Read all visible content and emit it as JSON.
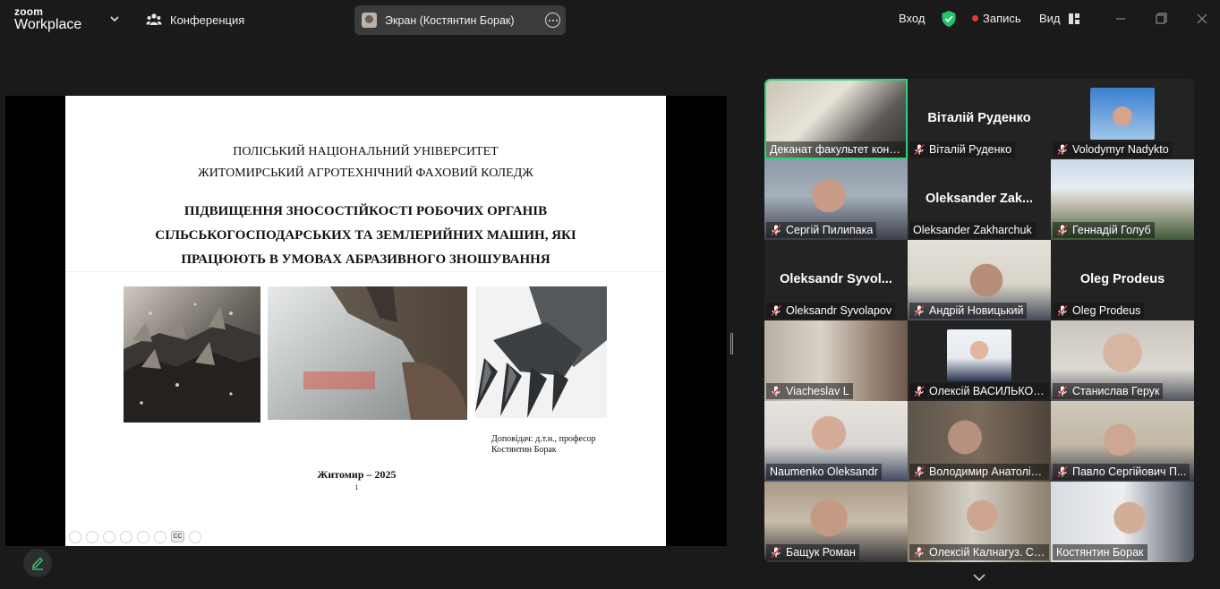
{
  "app": {
    "logo_top": "zoom",
    "logo_bottom": "Workplace",
    "meeting_label": "Конференция",
    "screen_share_label": "Экран (Костянтин Борак)",
    "login_label": "Вход",
    "record_label": "Запись",
    "view_label": "Вид",
    "shield_color": "#23c26b",
    "record_color": "#e53935",
    "active_speaker_color": "#2fd07a"
  },
  "slide": {
    "line1": "ПОЛІСЬКИЙ НАЦІОНАЛЬНИЙ УНІВЕРСИТЕТ",
    "line2": "ЖИТОМИРСЬКИЙ АГРОТЕХНІЧНИЙ ФАХОВИЙ КОЛЕДЖ",
    "title": [
      "ПІДВИЩЕННЯ ЗНОСОСТІЙКОСТІ РОБОЧИХ ОРГАНІВ",
      "СІЛЬСЬКОГОСПОДАРСЬКИХ ТА ЗЕМЛЕРИЙНИХ МАШИН, ЯКІ",
      "ПРАЦЮЮТЬ В УМОВАХ АБРАЗИВНОГО ЗНОШУВАННЯ"
    ],
    "speaker_line1": "Доповідач:  д.т.н., професор",
    "speaker_line2": "Костянтин Борак",
    "city_year": "Житомир – 2025",
    "page_number": "1",
    "cc_label": "CC"
  },
  "participants": [
    {
      "label": "Деканат факультет конс...",
      "muted": false,
      "video": true,
      "active": true
    },
    {
      "label": "Віталій Руденко",
      "big_name": "Віталій Руденко",
      "muted": true,
      "video": false
    },
    {
      "label": "Volodymyr Nadykto",
      "muted": true,
      "video": false,
      "avatar": true
    },
    {
      "label": "Сергій Пилипака",
      "muted": true,
      "video": true
    },
    {
      "label": "Oleksander Zakharchuk",
      "big_name": "Oleksander  Zak...",
      "muted": false,
      "video": false
    },
    {
      "label": "Геннадій Голуб",
      "muted": true,
      "video": true
    },
    {
      "label": "Oleksandr Syvolapov",
      "big_name": "Oleksandr  Syvol...",
      "muted": true,
      "video": false
    },
    {
      "label": "Андрій Новицький",
      "muted": true,
      "video": true
    },
    {
      "label": "Oleg Prodeus",
      "big_name": "Oleg Prodeus",
      "muted": true,
      "video": false
    },
    {
      "label": "Viacheslav L",
      "muted": true,
      "video": true
    },
    {
      "label": "Олексій ВАСИЛЬКОВ...",
      "muted": true,
      "video": false,
      "avatar": true
    },
    {
      "label": "Станислав Герук",
      "muted": true,
      "video": true
    },
    {
      "label": "Naumenko Oleksandr",
      "muted": false,
      "video": true
    },
    {
      "label": "Володимир Анатолій...",
      "muted": true,
      "video": true
    },
    {
      "label": "Павло Сергійович П...",
      "muted": true,
      "video": true
    },
    {
      "label": "Бащук Роман",
      "muted": true,
      "video": true
    },
    {
      "label": "Олексій Калнагуз. Су...",
      "muted": true,
      "video": true
    },
    {
      "label": "Костянтин Борак",
      "muted": false,
      "video": true
    }
  ]
}
